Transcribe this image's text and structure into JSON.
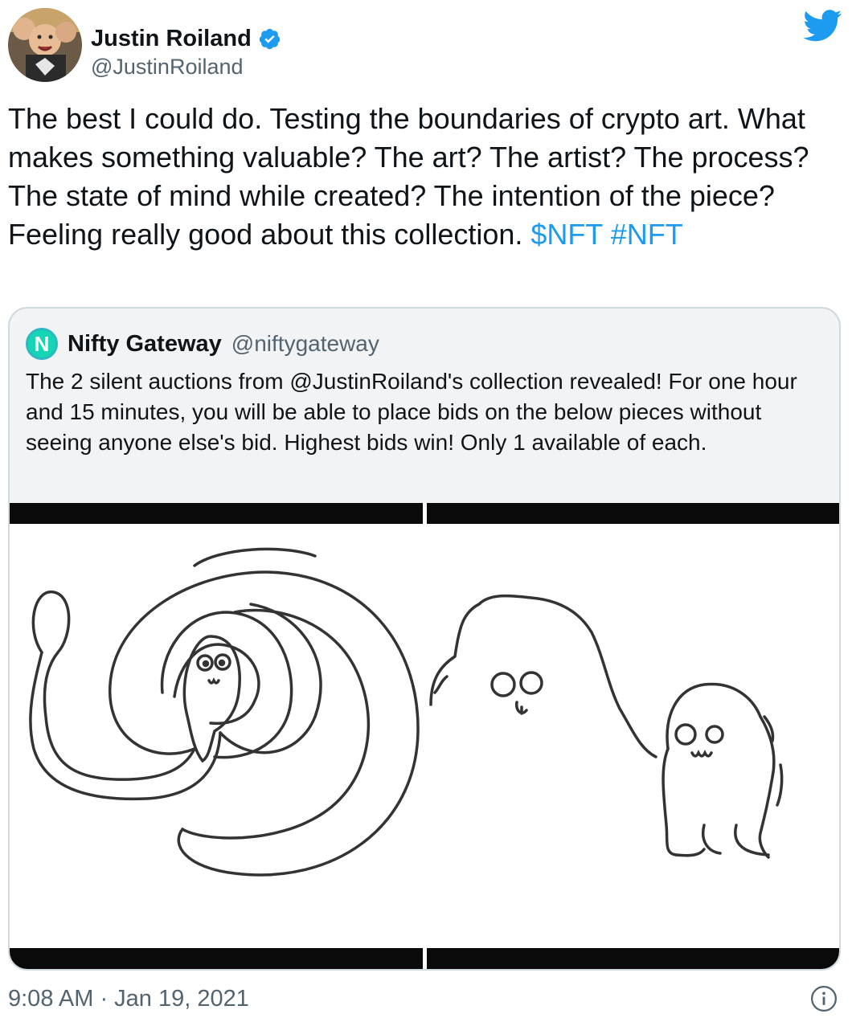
{
  "author": {
    "display_name": "Justin Roiland",
    "handle": "@JustinRoiland",
    "avatar_icon": "avatar-photo",
    "verified_icon": "verified-badge-icon"
  },
  "brand": {
    "icon": "twitter-bird-icon",
    "color": "#1d9bf0"
  },
  "tweet": {
    "text_main": "The best I could do. Testing the boundaries of crypto art. What makes something valuable? The art? The artist? The process? The state of mind while created? The intention of the piece? Feeling really good about this collection.",
    "cashtag": "$NFT",
    "hashtag": "#NFT"
  },
  "quote": {
    "logo_letter": "N",
    "display_name": "Nifty Gateway",
    "handle": "@niftygateway",
    "text": "The 2 silent auctions from @JustinRoiland's collection revealed! For one hour and 15 minutes, you will be able to place bids on the below pieces without seeing anyone else's bid. Highest bids win! Only 1 available of each.",
    "images": [
      "snake-drawing",
      "blob-creatures-drawing"
    ]
  },
  "footer": {
    "timestamp": "9:08 AM · Jan 19, 2021",
    "info_icon": "info-icon"
  }
}
